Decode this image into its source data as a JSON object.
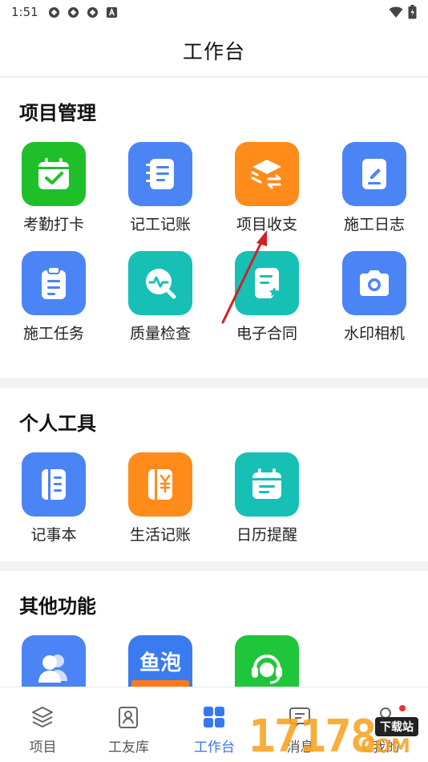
{
  "status": {
    "time": "1:51"
  },
  "header": {
    "title": "工作台"
  },
  "sections": [
    {
      "title": "项目管理",
      "items": [
        {
          "label": "考勤打卡",
          "icon": "calendar-check-icon",
          "color": "#1fbf2a"
        },
        {
          "label": "记工记账",
          "icon": "notebook-icon",
          "color": "#4b84f5"
        },
        {
          "label": "项目收支",
          "icon": "layers-exchange-icon",
          "color": "#ff8c1a"
        },
        {
          "label": "施工日志",
          "icon": "edit-note-icon",
          "color": "#4b84f5"
        },
        {
          "label": "施工任务",
          "icon": "clipboard-icon",
          "color": "#4b84f5"
        },
        {
          "label": "质量检查",
          "icon": "magnifier-pulse-icon",
          "color": "#16c0b5"
        },
        {
          "label": "电子合同",
          "icon": "contract-icon",
          "color": "#16c0b5"
        },
        {
          "label": "水印相机",
          "icon": "camera-icon",
          "color": "#4b84f5"
        }
      ]
    },
    {
      "title": "个人工具",
      "items": [
        {
          "label": "记事本",
          "icon": "memo-book-icon",
          "color": "#4b84f5"
        },
        {
          "label": "生活记账",
          "icon": "yuan-book-icon",
          "color": "#ff8c1a"
        },
        {
          "label": "日历提醒",
          "icon": "calendar-icon",
          "color": "#16c0b5"
        }
      ]
    },
    {
      "title": "其他功能",
      "items": [
        {
          "label": "",
          "icon": "users-icon",
          "color": "#4b84f5"
        },
        {
          "label": "",
          "icon": "yupao-logo-icon",
          "color": "#3a7cf0",
          "logo_text": "鱼泡"
        },
        {
          "label": "",
          "icon": "customer-service-icon",
          "color": "#20c63a"
        }
      ]
    }
  ],
  "tabbar": {
    "tabs": [
      {
        "label": "项目",
        "icon": "layers-icon",
        "active": false
      },
      {
        "label": "工友库",
        "icon": "contacts-icon",
        "active": false
      },
      {
        "label": "工作台",
        "icon": "grid-icon",
        "active": true
      },
      {
        "label": "消息",
        "icon": "message-icon",
        "active": false
      },
      {
        "label": "我的",
        "icon": "user-icon",
        "active": false
      }
    ]
  },
  "watermark": {
    "text": "17178",
    "suffix": "COM",
    "badge": "下载站"
  },
  "colors": {
    "accent": "#3478f6",
    "arrow": "#d42020"
  }
}
